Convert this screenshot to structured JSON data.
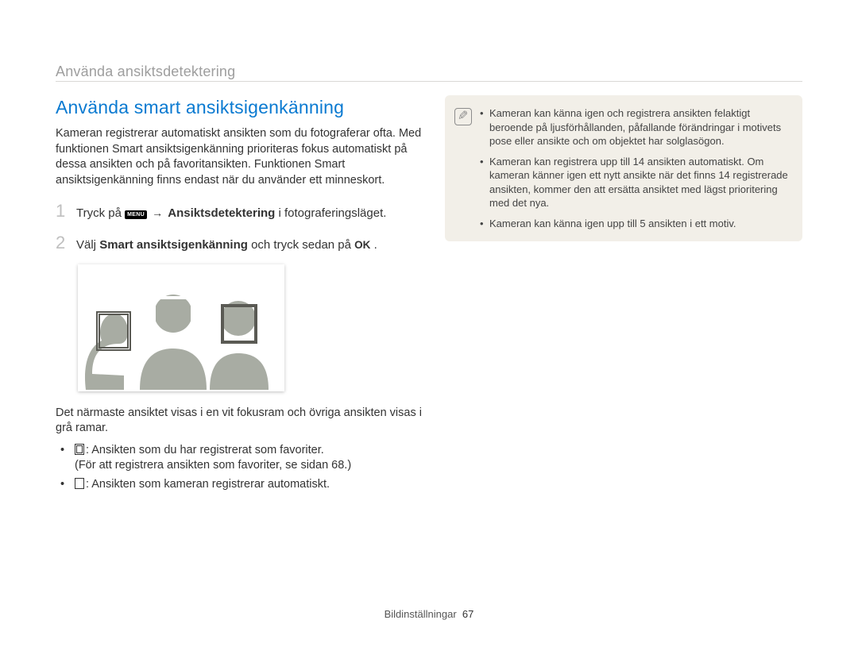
{
  "breadcrumb": "Använda ansiktsdetektering",
  "section_title": "Använda smart ansiktsigenkänning",
  "intro": "Kameran registrerar automatiskt ansikten som du fotograferar ofta. Med funktionen Smart ansiktsigenkänning prioriteras fokus automatiskt på dessa ansikten och på favoritansikten. Funktionen Smart ansiktsigenkänning finns endast när du använder ett minneskort.",
  "steps": [
    {
      "num": "1",
      "pre": "Tryck på ",
      "menu_label": "MENU",
      "mid_bold": "Ansiktsdetektering",
      "post": " i fotograferingsläget."
    },
    {
      "num": "2",
      "pre": "Välj ",
      "bold": "Smart ansiktsigenkänning",
      "mid": " och tryck sedan på ",
      "ok": "OK",
      "post": "."
    }
  ],
  "after_illu": "Det närmaste ansiktet visas i en vit fokusram och övriga ansikten visas i grå ramar.",
  "mini": [
    {
      "line1": ": Ansikten som du har registrerat som favoriter.",
      "line2": "(För att registrera ansikten som favoriter, se sidan 68.)"
    },
    {
      "line1": ": Ansikten som kameran registrerar automatiskt."
    }
  ],
  "notes": [
    "Kameran kan känna igen och registrera ansikten felaktigt beroende på ljusförhållanden, påfallande förändringar i motivets pose eller ansikte och om objektet har solglasögon.",
    "Kameran kan registrera upp till 14 ansikten automatiskt. Om kameran känner igen ett nytt ansikte när det finns 14 registrerade ansikten, kommer den att ersätta ansiktet med lägst prioritering med det nya.",
    "Kameran kan känna igen upp till 5 ansikten i ett motiv."
  ],
  "footer_label": "Bildinställningar",
  "footer_page": "67"
}
